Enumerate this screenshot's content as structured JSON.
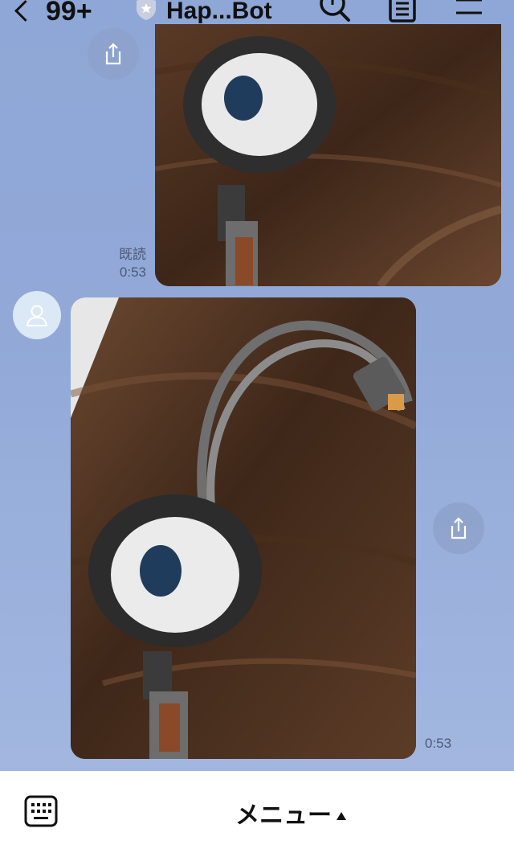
{
  "header": {
    "unread_count": "99+",
    "title": "Hap...Bot"
  },
  "messages": [
    {
      "side": "sent",
      "read_label": "既読",
      "time": "0:53"
    },
    {
      "side": "received",
      "time": "0:53"
    }
  ],
  "footer": {
    "menu_label": "メニュー"
  },
  "colors": {
    "background": "#92a9d8",
    "share_button": "#8ca0c8",
    "avatar_bg": "#dbe8f6"
  }
}
